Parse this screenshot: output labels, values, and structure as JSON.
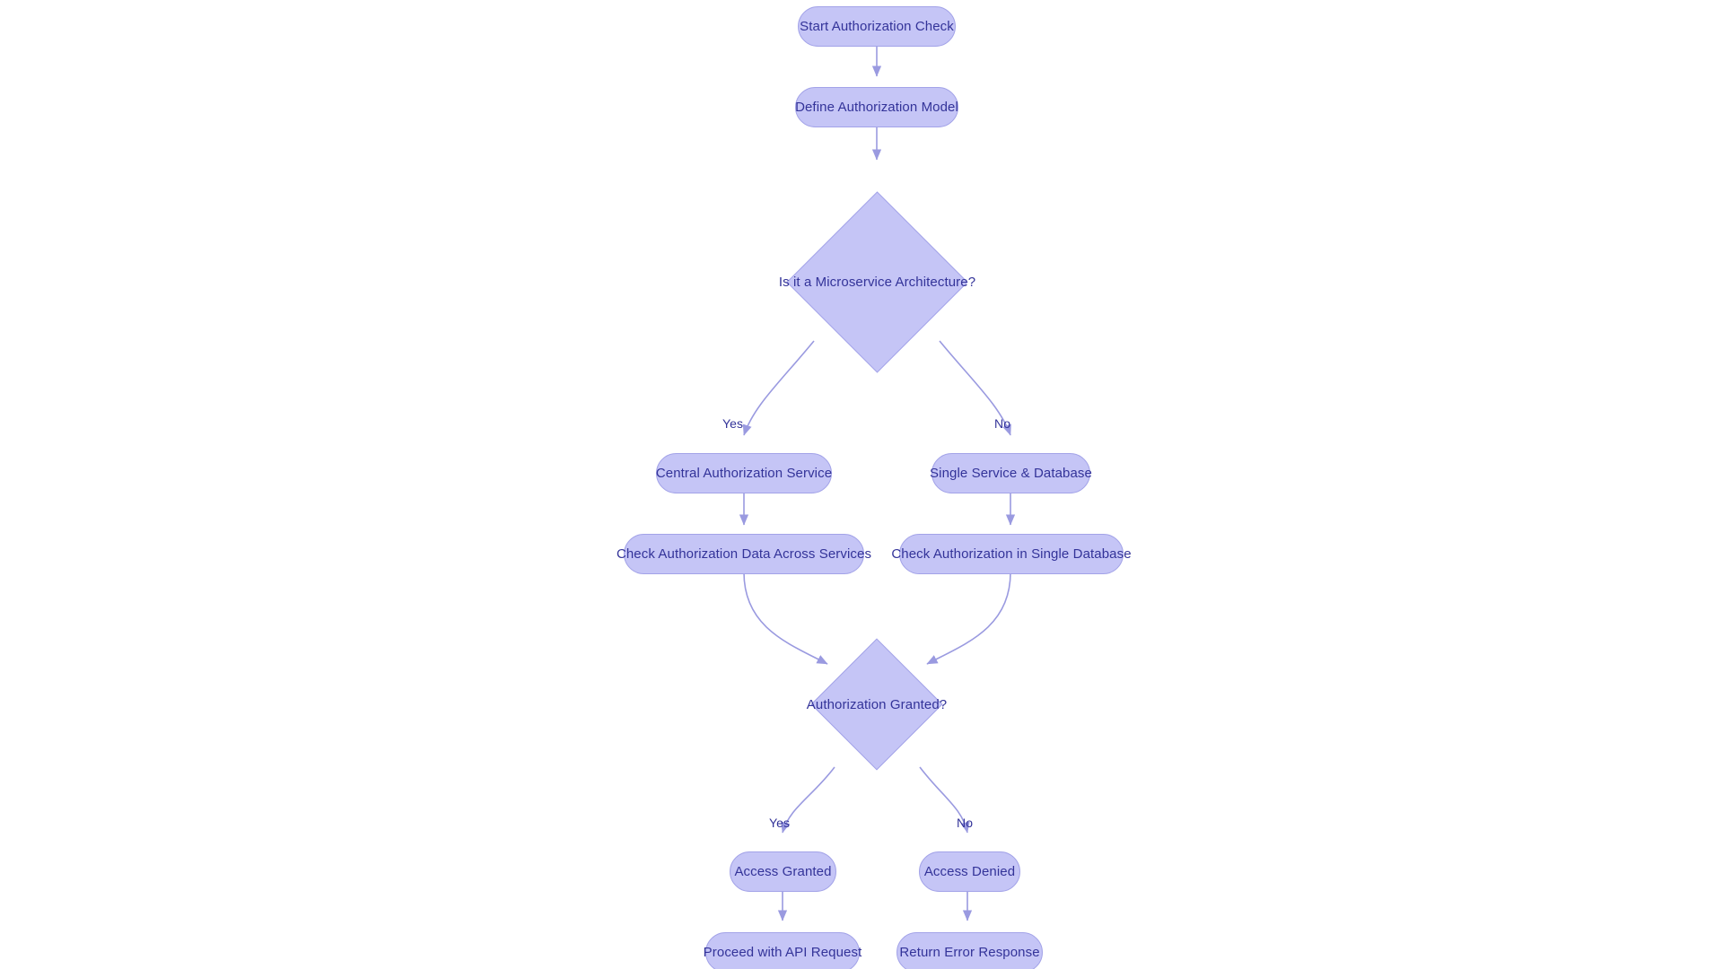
{
  "diagram": {
    "type": "flowchart",
    "title": "Authorization Check Flowchart",
    "orientation": "top-to-bottom",
    "colors": {
      "node_fill": "#c5c5f6",
      "node_border": "#a3a3e8",
      "node_text": "#333399",
      "edge_stroke": "#9a9ae0",
      "background": "#ffffff"
    },
    "nodes": [
      {
        "id": "start",
        "shape": "rounded",
        "label": "Start Authorization Check"
      },
      {
        "id": "define",
        "shape": "rounded",
        "label": "Define Authorization Model"
      },
      {
        "id": "micro",
        "shape": "diamond",
        "label": "Is it a Microservice Architecture?"
      },
      {
        "id": "central",
        "shape": "rounded",
        "label": "Central Authorization Service"
      },
      {
        "id": "single",
        "shape": "rounded",
        "label": "Single Service & Database"
      },
      {
        "id": "check_across",
        "shape": "rounded",
        "label": "Check Authorization Data Across Services"
      },
      {
        "id": "check_single",
        "shape": "rounded",
        "label": "Check Authorization in Single Database"
      },
      {
        "id": "granted_q",
        "shape": "diamond",
        "label": "Authorization Granted?"
      },
      {
        "id": "access_granted",
        "shape": "rounded",
        "label": "Access Granted"
      },
      {
        "id": "access_denied",
        "shape": "rounded",
        "label": "Access Denied"
      },
      {
        "id": "proceed",
        "shape": "rounded",
        "label": "Proceed with API Request"
      },
      {
        "id": "error",
        "shape": "rounded",
        "label": "Return Error Response"
      }
    ],
    "edges": [
      {
        "from": "start",
        "to": "define",
        "label": ""
      },
      {
        "from": "define",
        "to": "micro",
        "label": ""
      },
      {
        "from": "micro",
        "to": "central",
        "label": "Yes"
      },
      {
        "from": "micro",
        "to": "single",
        "label": "No"
      },
      {
        "from": "central",
        "to": "check_across",
        "label": ""
      },
      {
        "from": "single",
        "to": "check_single",
        "label": ""
      },
      {
        "from": "check_across",
        "to": "granted_q",
        "label": ""
      },
      {
        "from": "check_single",
        "to": "granted_q",
        "label": ""
      },
      {
        "from": "granted_q",
        "to": "access_granted",
        "label": "Yes"
      },
      {
        "from": "granted_q",
        "to": "access_denied",
        "label": "No"
      },
      {
        "from": "access_granted",
        "to": "proceed",
        "label": ""
      },
      {
        "from": "access_denied",
        "to": "error",
        "label": ""
      }
    ],
    "edge_labels": {
      "micro_yes": "Yes",
      "micro_no": "No",
      "granted_yes": "Yes",
      "granted_no": "No"
    }
  }
}
